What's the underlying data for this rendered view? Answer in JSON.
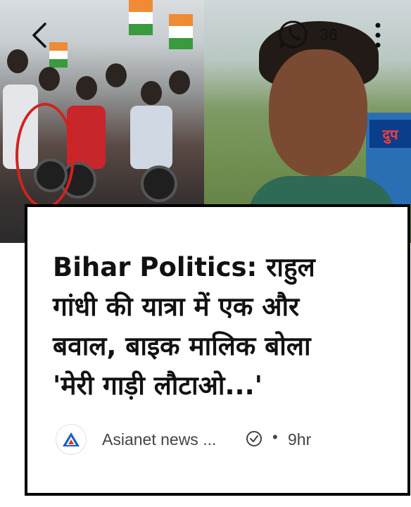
{
  "header": {
    "share_count": "36",
    "icons": [
      "back-arrow-icon",
      "whatsapp-icon",
      "more-vertical-icon"
    ]
  },
  "article": {
    "headline_lines": [
      "Bihar Politics: राहुल",
      "गांधी की यात्रा में एक और",
      "बवाल, बाइक मालिक बोला",
      "'मेरी गाड़ी लौटाओ...'"
    ],
    "source_name": "Asianet news ...",
    "time": "9hr",
    "separator": "•"
  },
  "hero": {
    "shop_sign": "दुप"
  },
  "colors": {
    "highlight_circle": "#d1231d",
    "card_border": "#000000",
    "asianet_logo_blue": "#1b5fbf"
  }
}
